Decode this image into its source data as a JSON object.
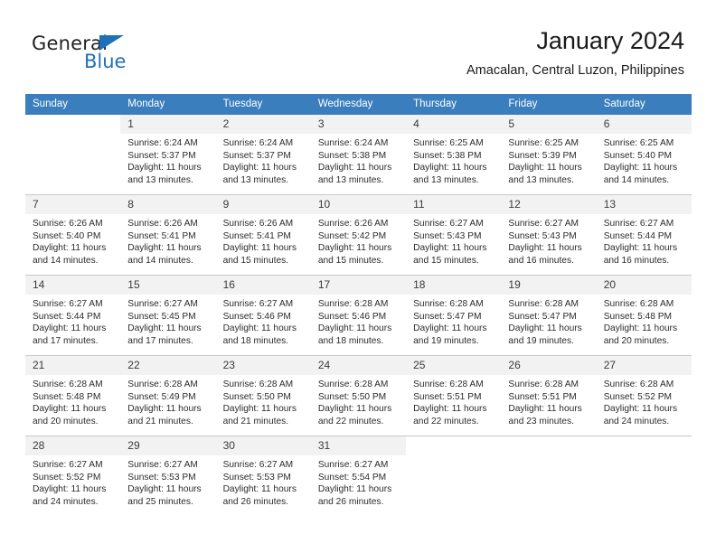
{
  "brand": {
    "name_part1": "General",
    "name_part2": "Blue",
    "accent_color": "#1e71b8"
  },
  "header": {
    "title": "January 2024",
    "subtitle": "Amacalan, Central Luzon, Philippines",
    "header_bg_color": "#3b7ebd",
    "daynum_bg_color": "#f2f2f2"
  },
  "weekdays": [
    "Sunday",
    "Monday",
    "Tuesday",
    "Wednesday",
    "Thursday",
    "Friday",
    "Saturday"
  ],
  "weeks": [
    [
      {
        "day": "",
        "sunrise": "",
        "sunset": "",
        "daylight_line1": "",
        "daylight_line2": ""
      },
      {
        "day": "1",
        "sunrise": "Sunrise: 6:24 AM",
        "sunset": "Sunset: 5:37 PM",
        "daylight_line1": "Daylight: 11 hours",
        "daylight_line2": "and 13 minutes."
      },
      {
        "day": "2",
        "sunrise": "Sunrise: 6:24 AM",
        "sunset": "Sunset: 5:37 PM",
        "daylight_line1": "Daylight: 11 hours",
        "daylight_line2": "and 13 minutes."
      },
      {
        "day": "3",
        "sunrise": "Sunrise: 6:24 AM",
        "sunset": "Sunset: 5:38 PM",
        "daylight_line1": "Daylight: 11 hours",
        "daylight_line2": "and 13 minutes."
      },
      {
        "day": "4",
        "sunrise": "Sunrise: 6:25 AM",
        "sunset": "Sunset: 5:38 PM",
        "daylight_line1": "Daylight: 11 hours",
        "daylight_line2": "and 13 minutes."
      },
      {
        "day": "5",
        "sunrise": "Sunrise: 6:25 AM",
        "sunset": "Sunset: 5:39 PM",
        "daylight_line1": "Daylight: 11 hours",
        "daylight_line2": "and 13 minutes."
      },
      {
        "day": "6",
        "sunrise": "Sunrise: 6:25 AM",
        "sunset": "Sunset: 5:40 PM",
        "daylight_line1": "Daylight: 11 hours",
        "daylight_line2": "and 14 minutes."
      }
    ],
    [
      {
        "day": "7",
        "sunrise": "Sunrise: 6:26 AM",
        "sunset": "Sunset: 5:40 PM",
        "daylight_line1": "Daylight: 11 hours",
        "daylight_line2": "and 14 minutes."
      },
      {
        "day": "8",
        "sunrise": "Sunrise: 6:26 AM",
        "sunset": "Sunset: 5:41 PM",
        "daylight_line1": "Daylight: 11 hours",
        "daylight_line2": "and 14 minutes."
      },
      {
        "day": "9",
        "sunrise": "Sunrise: 6:26 AM",
        "sunset": "Sunset: 5:41 PM",
        "daylight_line1": "Daylight: 11 hours",
        "daylight_line2": "and 15 minutes."
      },
      {
        "day": "10",
        "sunrise": "Sunrise: 6:26 AM",
        "sunset": "Sunset: 5:42 PM",
        "daylight_line1": "Daylight: 11 hours",
        "daylight_line2": "and 15 minutes."
      },
      {
        "day": "11",
        "sunrise": "Sunrise: 6:27 AM",
        "sunset": "Sunset: 5:43 PM",
        "daylight_line1": "Daylight: 11 hours",
        "daylight_line2": "and 15 minutes."
      },
      {
        "day": "12",
        "sunrise": "Sunrise: 6:27 AM",
        "sunset": "Sunset: 5:43 PM",
        "daylight_line1": "Daylight: 11 hours",
        "daylight_line2": "and 16 minutes."
      },
      {
        "day": "13",
        "sunrise": "Sunrise: 6:27 AM",
        "sunset": "Sunset: 5:44 PM",
        "daylight_line1": "Daylight: 11 hours",
        "daylight_line2": "and 16 minutes."
      }
    ],
    [
      {
        "day": "14",
        "sunrise": "Sunrise: 6:27 AM",
        "sunset": "Sunset: 5:44 PM",
        "daylight_line1": "Daylight: 11 hours",
        "daylight_line2": "and 17 minutes."
      },
      {
        "day": "15",
        "sunrise": "Sunrise: 6:27 AM",
        "sunset": "Sunset: 5:45 PM",
        "daylight_line1": "Daylight: 11 hours",
        "daylight_line2": "and 17 minutes."
      },
      {
        "day": "16",
        "sunrise": "Sunrise: 6:27 AM",
        "sunset": "Sunset: 5:46 PM",
        "daylight_line1": "Daylight: 11 hours",
        "daylight_line2": "and 18 minutes."
      },
      {
        "day": "17",
        "sunrise": "Sunrise: 6:28 AM",
        "sunset": "Sunset: 5:46 PM",
        "daylight_line1": "Daylight: 11 hours",
        "daylight_line2": "and 18 minutes."
      },
      {
        "day": "18",
        "sunrise": "Sunrise: 6:28 AM",
        "sunset": "Sunset: 5:47 PM",
        "daylight_line1": "Daylight: 11 hours",
        "daylight_line2": "and 19 minutes."
      },
      {
        "day": "19",
        "sunrise": "Sunrise: 6:28 AM",
        "sunset": "Sunset: 5:47 PM",
        "daylight_line1": "Daylight: 11 hours",
        "daylight_line2": "and 19 minutes."
      },
      {
        "day": "20",
        "sunrise": "Sunrise: 6:28 AM",
        "sunset": "Sunset: 5:48 PM",
        "daylight_line1": "Daylight: 11 hours",
        "daylight_line2": "and 20 minutes."
      }
    ],
    [
      {
        "day": "21",
        "sunrise": "Sunrise: 6:28 AM",
        "sunset": "Sunset: 5:48 PM",
        "daylight_line1": "Daylight: 11 hours",
        "daylight_line2": "and 20 minutes."
      },
      {
        "day": "22",
        "sunrise": "Sunrise: 6:28 AM",
        "sunset": "Sunset: 5:49 PM",
        "daylight_line1": "Daylight: 11 hours",
        "daylight_line2": "and 21 minutes."
      },
      {
        "day": "23",
        "sunrise": "Sunrise: 6:28 AM",
        "sunset": "Sunset: 5:50 PM",
        "daylight_line1": "Daylight: 11 hours",
        "daylight_line2": "and 21 minutes."
      },
      {
        "day": "24",
        "sunrise": "Sunrise: 6:28 AM",
        "sunset": "Sunset: 5:50 PM",
        "daylight_line1": "Daylight: 11 hours",
        "daylight_line2": "and 22 minutes."
      },
      {
        "day": "25",
        "sunrise": "Sunrise: 6:28 AM",
        "sunset": "Sunset: 5:51 PM",
        "daylight_line1": "Daylight: 11 hours",
        "daylight_line2": "and 22 minutes."
      },
      {
        "day": "26",
        "sunrise": "Sunrise: 6:28 AM",
        "sunset": "Sunset: 5:51 PM",
        "daylight_line1": "Daylight: 11 hours",
        "daylight_line2": "and 23 minutes."
      },
      {
        "day": "27",
        "sunrise": "Sunrise: 6:28 AM",
        "sunset": "Sunset: 5:52 PM",
        "daylight_line1": "Daylight: 11 hours",
        "daylight_line2": "and 24 minutes."
      }
    ],
    [
      {
        "day": "28",
        "sunrise": "Sunrise: 6:27 AM",
        "sunset": "Sunset: 5:52 PM",
        "daylight_line1": "Daylight: 11 hours",
        "daylight_line2": "and 24 minutes."
      },
      {
        "day": "29",
        "sunrise": "Sunrise: 6:27 AM",
        "sunset": "Sunset: 5:53 PM",
        "daylight_line1": "Daylight: 11 hours",
        "daylight_line2": "and 25 minutes."
      },
      {
        "day": "30",
        "sunrise": "Sunrise: 6:27 AM",
        "sunset": "Sunset: 5:53 PM",
        "daylight_line1": "Daylight: 11 hours",
        "daylight_line2": "and 26 minutes."
      },
      {
        "day": "31",
        "sunrise": "Sunrise: 6:27 AM",
        "sunset": "Sunset: 5:54 PM",
        "daylight_line1": "Daylight: 11 hours",
        "daylight_line2": "and 26 minutes."
      },
      {
        "day": "",
        "sunrise": "",
        "sunset": "",
        "daylight_line1": "",
        "daylight_line2": ""
      },
      {
        "day": "",
        "sunrise": "",
        "sunset": "",
        "daylight_line1": "",
        "daylight_line2": ""
      },
      {
        "day": "",
        "sunrise": "",
        "sunset": "",
        "daylight_line1": "",
        "daylight_line2": ""
      }
    ]
  ]
}
